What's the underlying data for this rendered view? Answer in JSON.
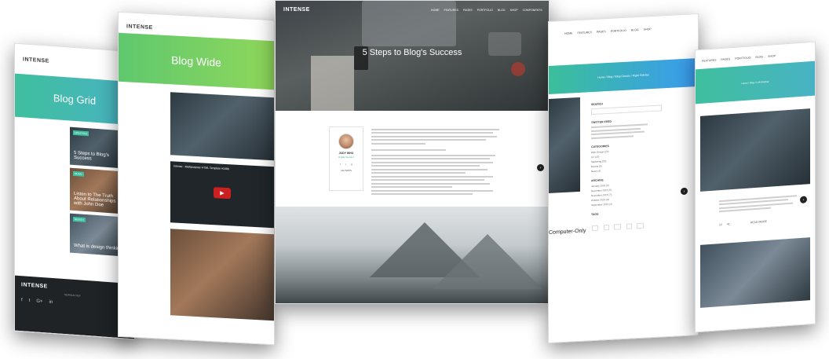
{
  "brand": "INTENSE",
  "nav": {
    "items": [
      "HOME",
      "FEATURES",
      "PAGES",
      "PORTFOLIO",
      "BLOG",
      "SHOP",
      "COMPONENTS"
    ]
  },
  "page_grid": {
    "hero_title": "Blog Grid",
    "cards": [
      {
        "tag": "LIFESTYLE",
        "title": "5 Steps to Blog's Success"
      },
      {
        "tag": "MUSIC",
        "title": "Listen to The Truth About Relationships with John Doe"
      },
      {
        "tag": "DESIGN",
        "title": "What is design thinking"
      }
    ],
    "footer_label": "NEWSLETTER",
    "social_icons": [
      "facebook-icon",
      "twitter-icon",
      "googleplus-icon",
      "linkedin-icon"
    ]
  },
  "page_wide": {
    "hero_title": "Blog Wide",
    "video_title": "Intense - Multipurpose HTML Template #1086"
  },
  "page_center": {
    "post_title": "5 Steps to Blog's Success",
    "author": {
      "name": "JUDY WHO",
      "role": "Digital Operator",
      "posts_label": "ALL POSTS"
    }
  },
  "page_sidebar": {
    "breadcrumb": "Home / Blog / Blog Classic / Right Sidebar",
    "section_title": "Computer-Only",
    "sidebar": {
      "search_label": "SEARCH",
      "twitter_label": "TWITTER FEED",
      "categories_label": "CATEGORIES",
      "categories": [
        "Web Design (22)",
        "UX (15)",
        "Marketing (15)",
        "Events (5)",
        "News (4)"
      ],
      "archive_label": "ARCHIVE",
      "archive": [
        "January 2016 (2)",
        "December 2015 (5)",
        "November 2015 (7)",
        "October 2015 (3)",
        "September 2015 (4)"
      ],
      "tags_label": "TAGS"
    }
  },
  "page_right": {
    "breadcrumb": "Home / Blog / Left Sidebar",
    "comments": "12",
    "likes": "41",
    "read_more": "READ MORE"
  },
  "colors": {
    "teal": "#3fbf9e",
    "green": "#6ccc64",
    "blue": "#3a9bf0",
    "dark": "#1f2326"
  }
}
